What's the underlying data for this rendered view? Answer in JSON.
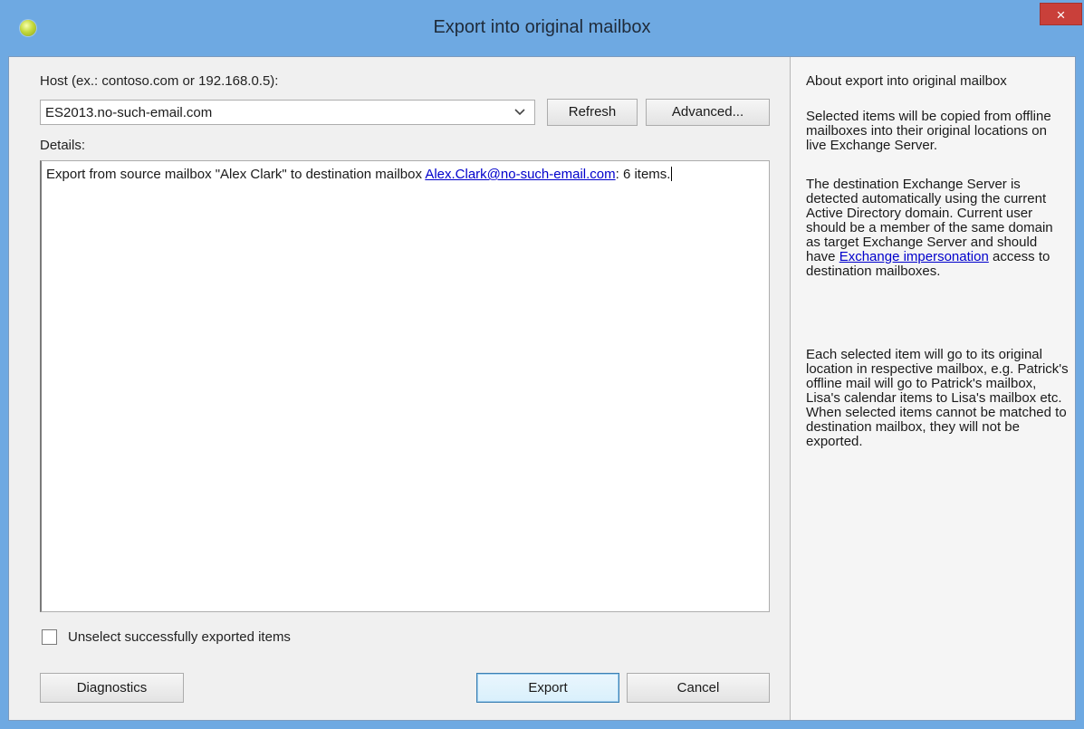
{
  "window": {
    "title": "Export into original mailbox",
    "close_glyph": "×",
    "accent_color": "#6ea9e2"
  },
  "form": {
    "host_label": "Host (ex.: contoso.com or 192.168.0.5):",
    "host_value": "ES2013.no-such-email.com",
    "refresh_label": "Refresh",
    "advanced_label": "Advanced...",
    "details_label": "Details:",
    "details_prefix": "Export from source mailbox \"Alex Clark\" to destination mailbox ",
    "details_link": "Alex.Clark@no-such-email.com",
    "details_suffix": ": 6 items.",
    "unselect_label": "Unselect successfully exported items",
    "unselect_checked": false
  },
  "footer": {
    "diagnostics_label": "Diagnostics",
    "export_label": "Export",
    "cancel_label": "Cancel"
  },
  "sidebar": {
    "heading": "About export into original mailbox",
    "p1": "Selected items will be copied from offline mailboxes into their original locations on live Exchange Server.",
    "p2_pre": "The destination Exchange Server is detected automatically using the current Active Directory domain. Current user should be a member of the same domain as target Exchange Server and should have ",
    "p2_link": "Exchange impersonation",
    "p2_post": " access to destination mailboxes.",
    "p3": "Each selected item will go to its original location in respective mailbox, e.g. Patrick's offline mail will go to Patrick's mailbox, Lisa's calendar items to Lisa's mailbox etc. When selected items cannot be matched to destination mailbox, they will not be exported."
  },
  "icons": {
    "app": "app-orb-icon",
    "close": "close-icon",
    "dropdown": "chevron-down-icon"
  }
}
